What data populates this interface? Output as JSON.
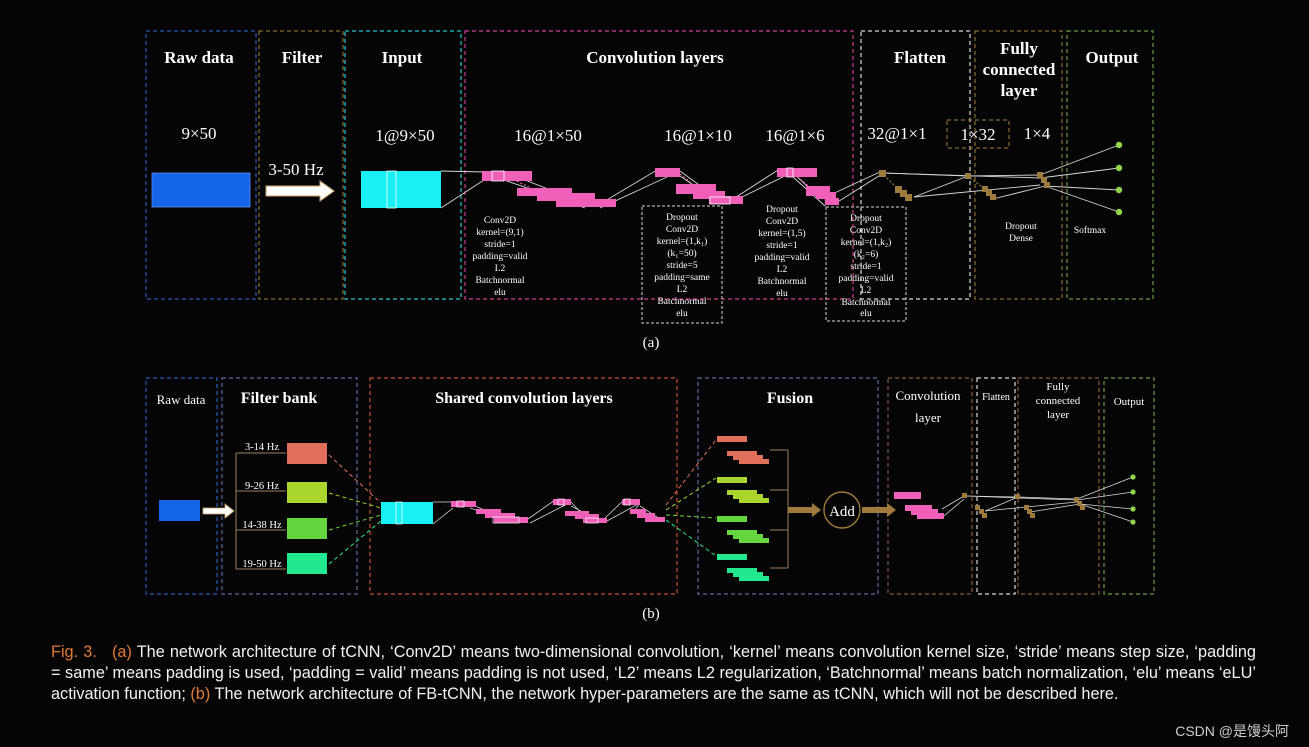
{
  "panel_a": {
    "headers": [
      "Raw data",
      "Filter",
      "Input",
      "Convolution layers",
      "Flatten",
      "Fully connected layer",
      "Output"
    ],
    "fc_header_lines": [
      "Fully",
      "connected",
      "layer"
    ],
    "dims": [
      "9×50",
      "1@9×50",
      "16@1×50",
      "16@1×10",
      "16@1×6",
      "32@1×1",
      "1×32",
      "1×4"
    ],
    "filter_label": "3-50 Hz",
    "note_conv1": [
      "Conv2D",
      "kernel=(9,1)",
      "stride=1",
      "padding=valid",
      "L2",
      "Batchnormal",
      "elu"
    ],
    "note_conv2": [
      "Dropout",
      "Conv2D",
      "kernel=(1,k₁)",
      "(k₁=50)",
      "stride=5",
      "padding=same",
      "L2",
      "Batchnormal",
      "elu"
    ],
    "note_conv3": [
      "Dropout",
      "Conv2D",
      "kernel=(1,5)",
      "stride=1",
      "padding=valid",
      "L2",
      "Batchnormal",
      "elu"
    ],
    "note_conv4": [
      "Dropout",
      "Conv2D",
      "kernel=(1,k₂)",
      "(k₂=6)",
      "stride=1",
      "padding=valid",
      "L2",
      "Batchnormal",
      "elu"
    ],
    "note_dense": [
      "Dropout",
      "Dense"
    ],
    "note_softmax": "Softmax",
    "label": "(a)"
  },
  "panel_b": {
    "headers": [
      "Raw data",
      "Filter bank",
      "Shared convolution layers",
      "Fusion",
      "Convolution layer",
      "Flatten",
      "Fully connected layer",
      "Output"
    ],
    "conv_header_lines": [
      "Convolution",
      "layer"
    ],
    "fc_header_lines": [
      "Fully",
      "connected",
      "layer"
    ],
    "bands": [
      "3-14 Hz",
      "9-26 Hz",
      "14-38 Hz",
      "19-50 Hz"
    ],
    "add_label": "Add",
    "label": "(b)"
  },
  "caption": {
    "fig": "Fig. 3.",
    "a_tag": "(a)",
    "a_text": "The network architecture of tCNN, ‘Conv2D’ means two-dimensional convolution, ‘kernel’ means convolution kernel size, ‘stride’ means step size, ‘padding = same’ means padding is used, ‘padding = valid’ means padding is not used, ‘L2’ means L2 regularization, ‘Batchnormal’ means batch normalization, ‘elu’ means ‘eLU’ activation function;",
    "b_tag": "(b)",
    "b_text": "The network architecture of FB-tCNN, the network hyper-parameters are the same as tCNN, which will not be described here."
  },
  "watermark": "CSDN @是馒头阿",
  "colors": {
    "raw_blue": "#1565e8",
    "input_cyan": "#18f0f5",
    "conv_pink": "#f060b8",
    "feature_tan": "#a07a3c",
    "output_green": "#8fd64a",
    "band1": "#e0705a",
    "band2": "#aad42e",
    "band3": "#66d640",
    "band4": "#22e890",
    "caption_orange": "#e07a36"
  }
}
